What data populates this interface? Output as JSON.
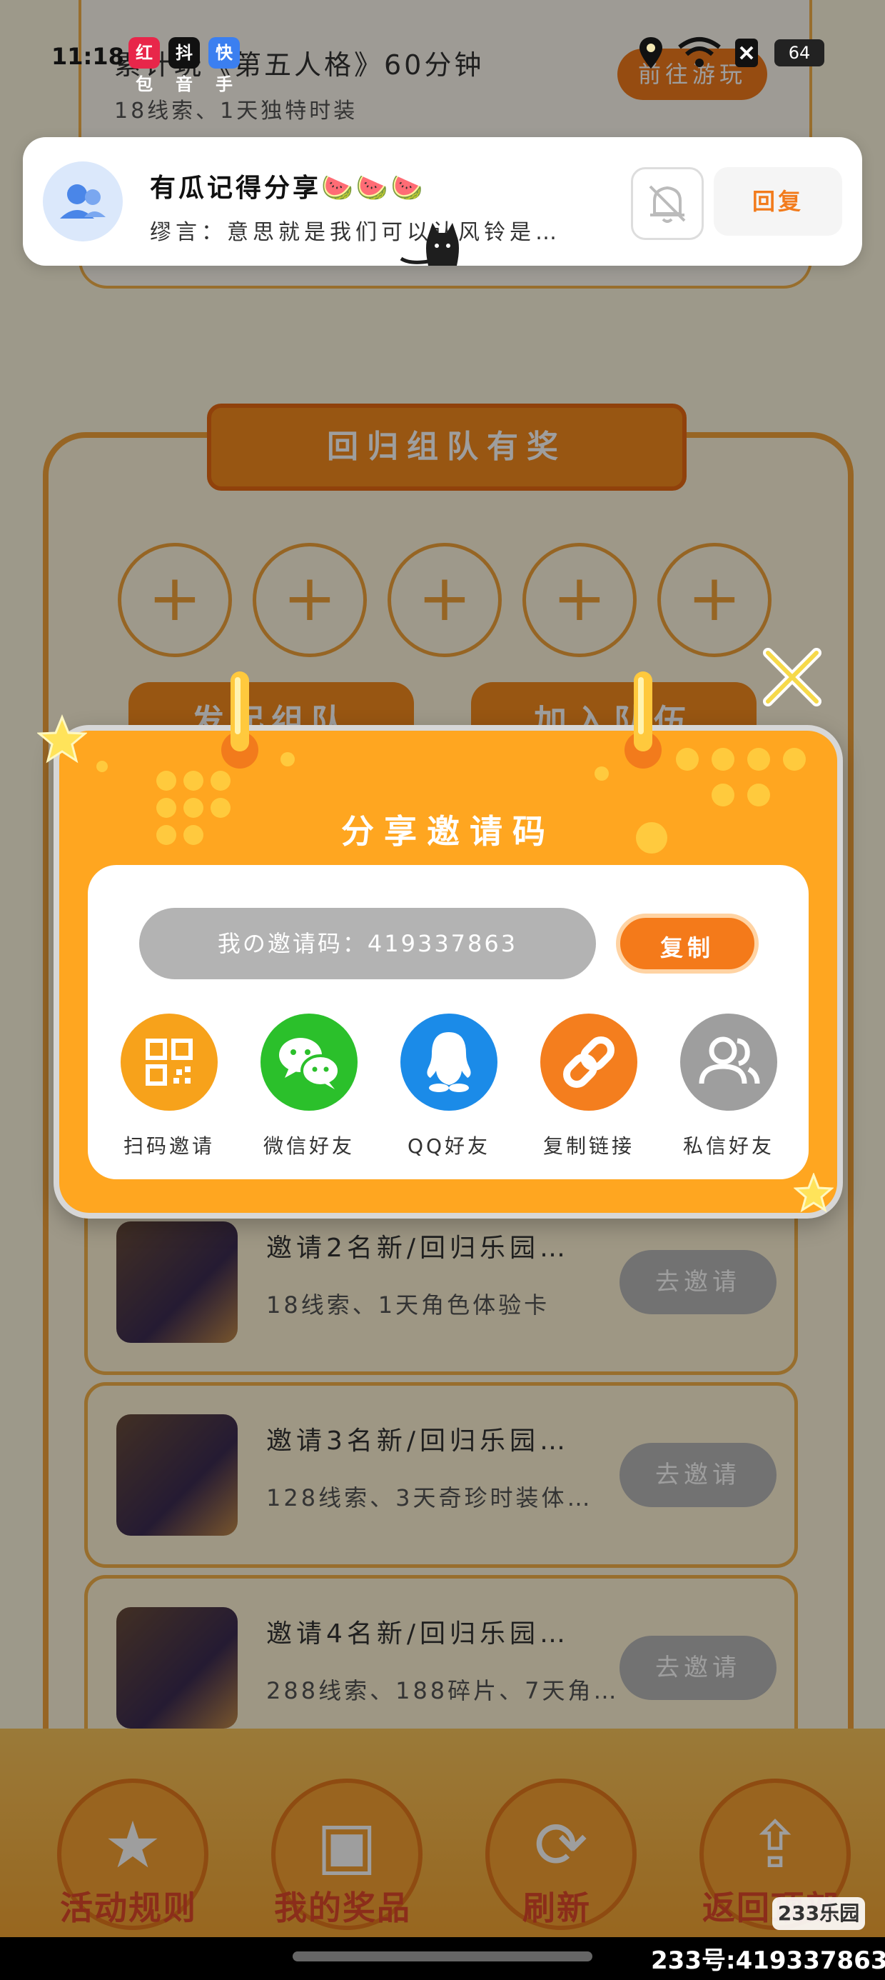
{
  "status_bar": {
    "time": "11:18",
    "apps": [
      "红包",
      "抖音",
      "快手"
    ],
    "battery": "64"
  },
  "background": {
    "top_task": {
      "title": "累计玩《第五人格》60分钟",
      "reward": "18线索、1天独特时装",
      "button": "前往游玩"
    },
    "banner": "回归组队有奖",
    "slots": [
      "+",
      "+",
      "+",
      "+",
      "+"
    ],
    "action_buttons": [
      "发起组队",
      "加入队伍"
    ],
    "invite_tasks": [
      {
        "title": "邀请2名新/回归乐园…",
        "reward": "18线索、1天角色体验卡",
        "button": "去邀请"
      },
      {
        "title": "邀请3名新/回归乐园…",
        "reward": "128线索、3天奇珍时装体…",
        "button": "去邀请"
      },
      {
        "title": "邀请4名新/回归乐园…",
        "reward": "288线索、188碎片、7天角…",
        "button": "去邀请"
      }
    ],
    "bottom_nav": [
      {
        "label": "活动规则",
        "icon": "star-icon"
      },
      {
        "label": "我的奖品",
        "icon": "gift-icon"
      },
      {
        "label": "刷新",
        "icon": "refresh-icon"
      },
      {
        "label": "返回顶部",
        "icon": "upload-icon"
      }
    ]
  },
  "notification": {
    "title": "有瓜记得分享🍉🍉🍉",
    "body": "缪言：意思就是我们可以认风铃是…",
    "reply_label": "回复"
  },
  "modal": {
    "title": "分享邀请码",
    "code_text": "我の邀请码：419337863",
    "copy_label": "复制",
    "share_options": [
      {
        "label": "扫码邀请",
        "icon": "qrcode-icon",
        "color": "#f7a21b"
      },
      {
        "label": "微信好友",
        "icon": "wechat-icon",
        "color": "#2bc02b"
      },
      {
        "label": "QQ好友",
        "icon": "qq-icon",
        "color": "#1b8be8"
      },
      {
        "label": "复制链接",
        "icon": "link-icon",
        "color": "#f47e1e"
      },
      {
        "label": "私信好友",
        "icon": "friends-icon",
        "color": "#9e9e9e"
      }
    ]
  },
  "watermark": {
    "text": "233号:419337863",
    "logo": "233乐园"
  }
}
